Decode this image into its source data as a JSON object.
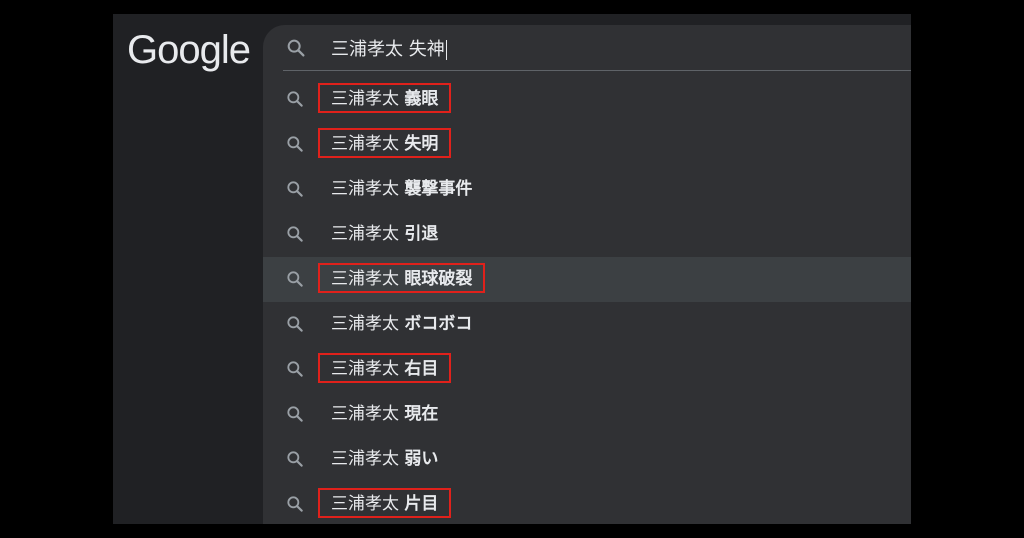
{
  "logo": "Google",
  "search": {
    "query": "三浦孝太 失神"
  },
  "suggestions": [
    {
      "prefix": "三浦孝太",
      "suffix": "義眼",
      "marked": true,
      "highlighted": false
    },
    {
      "prefix": "三浦孝太",
      "suffix": "失明",
      "marked": true,
      "highlighted": false
    },
    {
      "prefix": "三浦孝太",
      "suffix": "襲撃事件",
      "marked": false,
      "highlighted": false
    },
    {
      "prefix": "三浦孝太",
      "suffix": "引退",
      "marked": false,
      "highlighted": false
    },
    {
      "prefix": "三浦孝太",
      "suffix": "眼球破裂",
      "marked": true,
      "highlighted": true
    },
    {
      "prefix": "三浦孝太",
      "suffix": "ボコボコ",
      "marked": false,
      "highlighted": false
    },
    {
      "prefix": "三浦孝太",
      "suffix": "右目",
      "marked": true,
      "highlighted": false
    },
    {
      "prefix": "三浦孝太",
      "suffix": "現在",
      "marked": false,
      "highlighted": false
    },
    {
      "prefix": "三浦孝太",
      "suffix": "弱い",
      "marked": false,
      "highlighted": false
    },
    {
      "prefix": "三浦孝太",
      "suffix": "片目",
      "marked": true,
      "highlighted": false
    }
  ],
  "colors": {
    "background": "#202124",
    "panel": "#303134",
    "highlight": "#3c4043",
    "marker": "#e0211b",
    "text": "#e8eaed",
    "icon": "#9aa0a6"
  }
}
